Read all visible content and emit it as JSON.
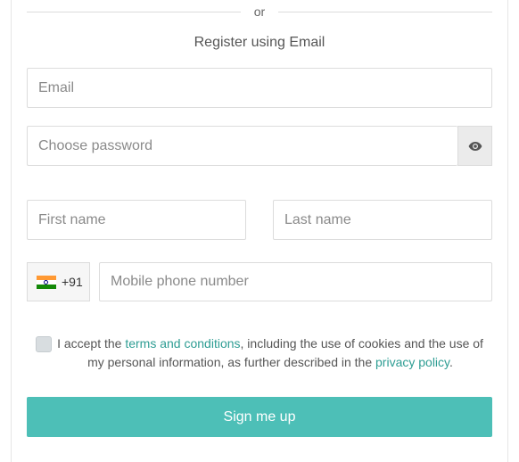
{
  "divider": {
    "text": "or"
  },
  "form": {
    "subtitle": "Register using Email",
    "email": {
      "placeholder": "Email",
      "value": ""
    },
    "password": {
      "placeholder": "Choose password",
      "value": "",
      "toggle_icon": "eye-icon"
    },
    "first_name": {
      "placeholder": "First name",
      "value": ""
    },
    "last_name": {
      "placeholder": "Last name",
      "value": ""
    },
    "country": {
      "flag": "india-flag-icon",
      "dial_code": "+91"
    },
    "phone": {
      "placeholder": "Mobile phone number",
      "value": ""
    },
    "consent": {
      "checked": false,
      "text_before": "I accept the ",
      "terms_link": "terms and conditions",
      "text_middle": ", including the use of cookies and the use of my personal information, as further described in the ",
      "privacy_link": "privacy policy",
      "text_after": "."
    },
    "submit_label": "Sign me up"
  },
  "colors": {
    "accent": "#4dbfb7",
    "link": "#2e9d93",
    "border": "#dcdcdc"
  }
}
